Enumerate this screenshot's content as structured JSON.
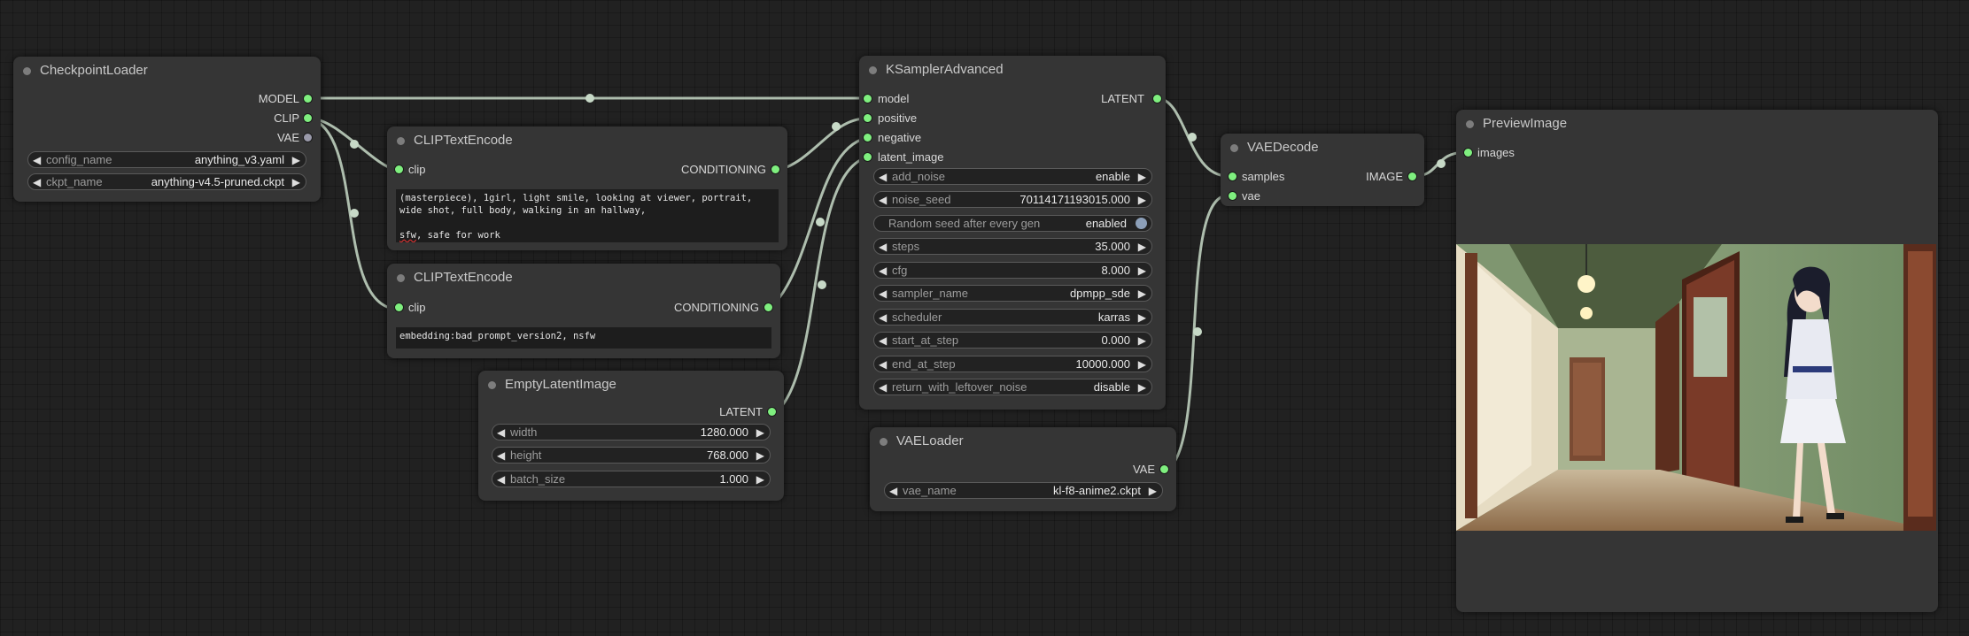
{
  "nodes": {
    "checkpoint_loader": {
      "title": "CheckpointLoader",
      "outputs": [
        "MODEL",
        "CLIP",
        "VAE"
      ],
      "widgets": [
        {
          "label": "config_name",
          "value": "anything_v3.yaml"
        },
        {
          "label": "ckpt_name",
          "value": "anything-v4.5-pruned.ckpt"
        }
      ]
    },
    "clip_text_encode_pos": {
      "title": "CLIPTextEncode",
      "input": "clip",
      "output": "CONDITIONING",
      "text_line1": "(masterpiece), 1girl, light smile, looking at viewer, portrait, wide shot, full body, walking in an hallway,",
      "text_line2_word": "sfw",
      "text_line2_rest": ", safe for work"
    },
    "clip_text_encode_neg": {
      "title": "CLIPTextEncode",
      "input": "clip",
      "output": "CONDITIONING",
      "text": "embedding:bad_prompt_version2, nsfw"
    },
    "empty_latent_image": {
      "title": "EmptyLatentImage",
      "output": "LATENT",
      "widgets": [
        {
          "label": "width",
          "value": "1280.000"
        },
        {
          "label": "height",
          "value": "768.000"
        },
        {
          "label": "batch_size",
          "value": "1.000"
        }
      ]
    },
    "ksampler_advanced": {
      "title": "KSamplerAdvanced",
      "inputs": [
        "model",
        "positive",
        "negative",
        "latent_image"
      ],
      "output": "LATENT",
      "widgets": [
        {
          "label": "add_noise",
          "value": "enable"
        },
        {
          "label": "noise_seed",
          "value": "70114171193015.000"
        },
        {
          "label": "Random seed after every gen",
          "value": "enabled",
          "toggle": true
        },
        {
          "label": "steps",
          "value": "35.000"
        },
        {
          "label": "cfg",
          "value": "8.000"
        },
        {
          "label": "sampler_name",
          "value": "dpmpp_sde"
        },
        {
          "label": "scheduler",
          "value": "karras"
        },
        {
          "label": "start_at_step",
          "value": "0.000"
        },
        {
          "label": "end_at_step",
          "value": "10000.000"
        },
        {
          "label": "return_with_leftover_noise",
          "value": "disable"
        }
      ]
    },
    "vae_loader": {
      "title": "VAELoader",
      "output": "VAE",
      "widgets": [
        {
          "label": "vae_name",
          "value": "kl-f8-anime2.ckpt"
        }
      ]
    },
    "vae_decode": {
      "title": "VAEDecode",
      "inputs": [
        "samples",
        "vae"
      ],
      "output": "IMAGE"
    },
    "preview_image": {
      "title": "PreviewImage",
      "input": "images"
    }
  },
  "colors": {
    "canvas": "#212121",
    "node_body": "#353535",
    "socket_active": "#7fef7f",
    "socket_idle": "#9a9aaa",
    "link": "#c7d9c7"
  },
  "icons": {
    "widget_left": "triangle-left",
    "widget_right": "triangle-right",
    "toggle": "circle-knob"
  }
}
